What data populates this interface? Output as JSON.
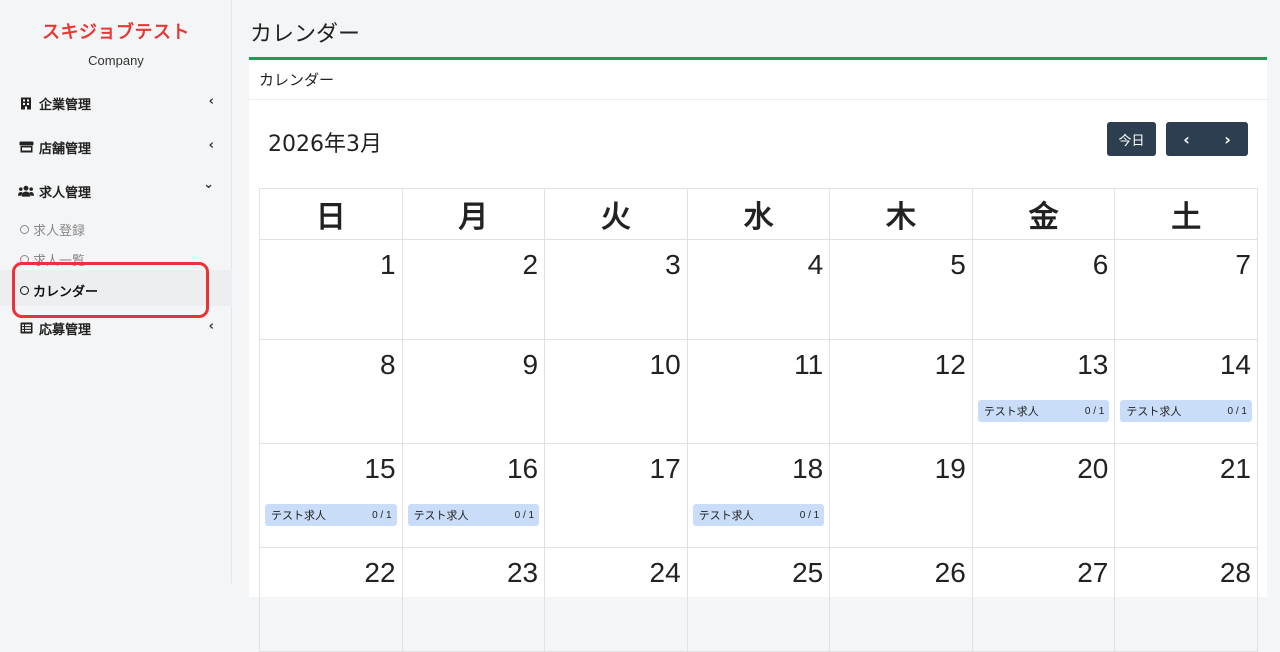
{
  "sidebar": {
    "brand": "スキジョブテスト",
    "company": "Company",
    "items": [
      {
        "label": "企業管理",
        "icon": "building-icon",
        "chevron": "‹"
      },
      {
        "label": "店舗管理",
        "icon": "store-icon",
        "chevron": "‹"
      },
      {
        "label": "求人管理",
        "icon": "users-icon",
        "chevron": "⌄"
      },
      {
        "label": "応募管理",
        "icon": "list-icon",
        "chevron": "‹"
      }
    ],
    "subitems": [
      {
        "label": "求人登録"
      },
      {
        "label": "求人一覧"
      },
      {
        "label": "カレンダー"
      }
    ]
  },
  "page": {
    "title": "カレンダー",
    "card_header": "カレンダー"
  },
  "calendar": {
    "month_label": "2026年3月",
    "today_label": "今日",
    "prev_label": "‹",
    "next_label": "›",
    "weekdays": [
      "日",
      "月",
      "火",
      "水",
      "木",
      "金",
      "土"
    ],
    "weeks": [
      [
        {
          "day": "1"
        },
        {
          "day": "2"
        },
        {
          "day": "3"
        },
        {
          "day": "4"
        },
        {
          "day": "5"
        },
        {
          "day": "6"
        },
        {
          "day": "7"
        }
      ],
      [
        {
          "day": "8"
        },
        {
          "day": "9"
        },
        {
          "day": "10"
        },
        {
          "day": "11"
        },
        {
          "day": "12"
        },
        {
          "day": "13",
          "event": {
            "name": "テスト求人",
            "count": "0 / 1"
          }
        },
        {
          "day": "14",
          "event": {
            "name": "テスト求人",
            "count": "0 / 1"
          }
        }
      ],
      [
        {
          "day": "15",
          "event": {
            "name": "テスト求人",
            "count": "0 / 1"
          }
        },
        {
          "day": "16",
          "event": {
            "name": "テスト求人",
            "count": "0 / 1"
          }
        },
        {
          "day": "17"
        },
        {
          "day": "18",
          "event": {
            "name": "テスト求人",
            "count": "0 / 1"
          }
        },
        {
          "day": "19"
        },
        {
          "day": "20"
        },
        {
          "day": "21"
        }
      ],
      [
        {
          "day": "22"
        },
        {
          "day": "23"
        },
        {
          "day": "24"
        },
        {
          "day": "25"
        },
        {
          "day": "26"
        },
        {
          "day": "27"
        },
        {
          "day": "28"
        }
      ]
    ]
  }
}
